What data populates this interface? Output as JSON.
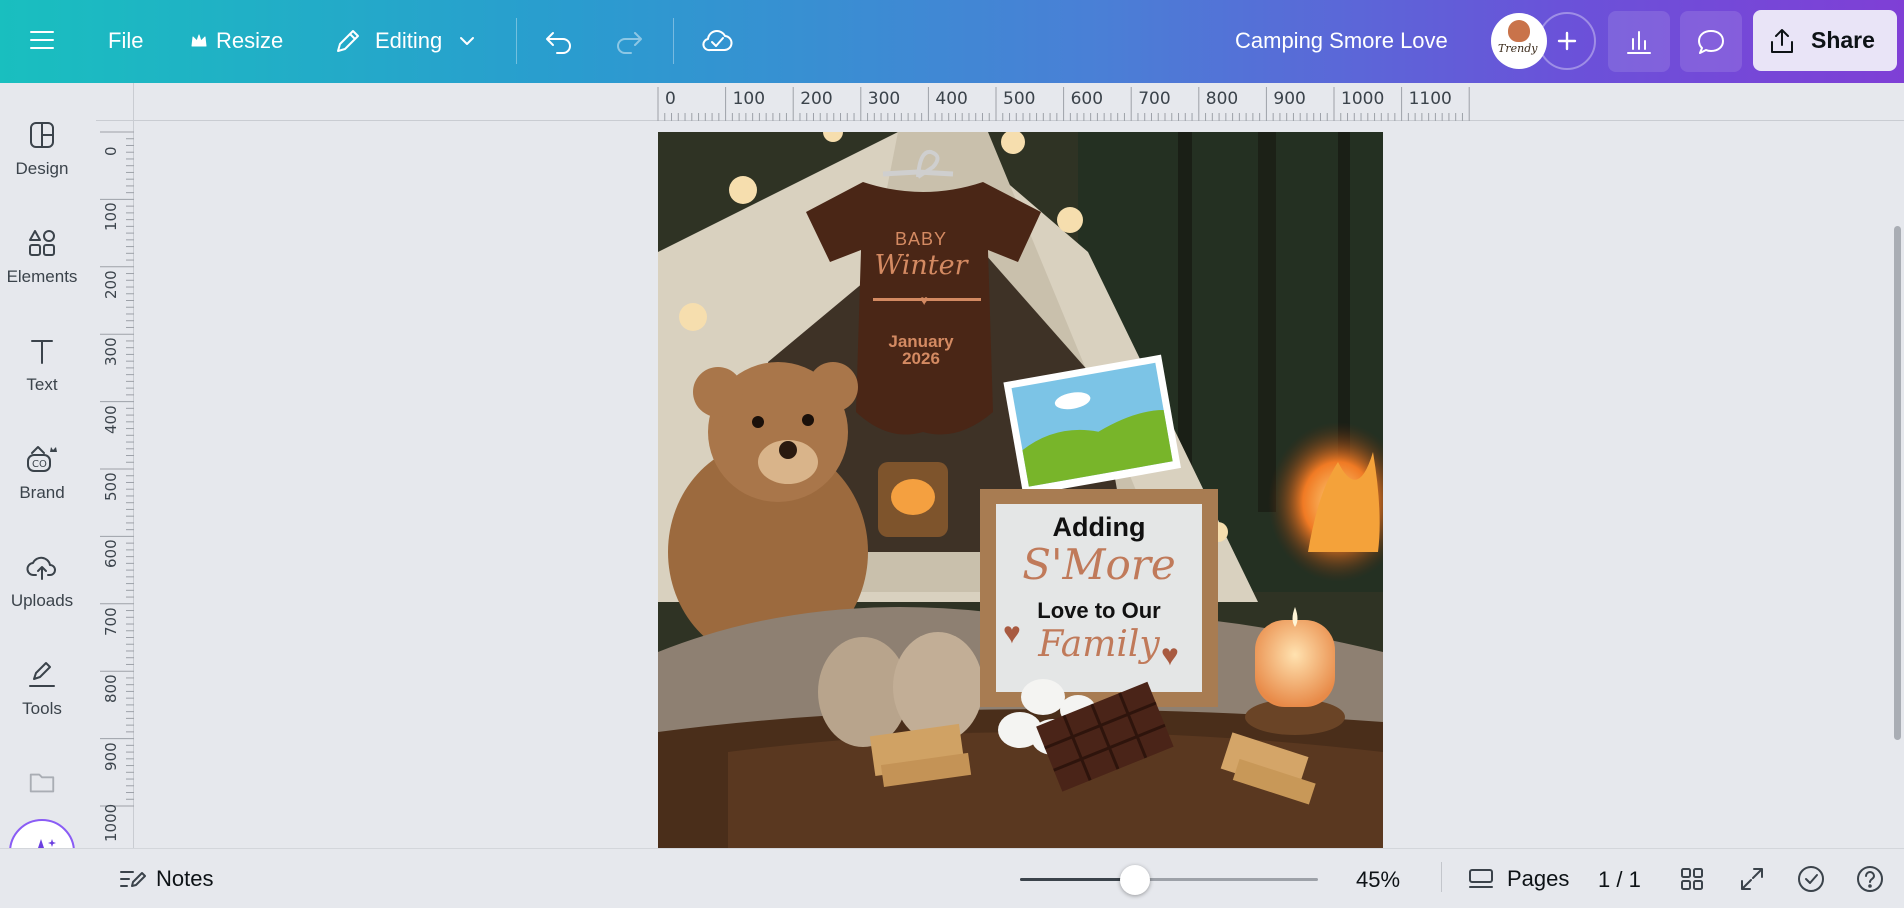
{
  "topbar": {
    "file_label": "File",
    "resize_label": "Resize",
    "editing_label": "Editing",
    "design_title": "Camping Smore Love",
    "share_label": "Share",
    "avatar_text": "Trendy"
  },
  "sidebar": {
    "items": [
      {
        "label": "Design",
        "icon": "design-layout-icon"
      },
      {
        "label": "Elements",
        "icon": "shapes-icon"
      },
      {
        "label": "Text",
        "icon": "text-t-icon"
      },
      {
        "label": "Brand",
        "icon": "brand-kit-icon"
      },
      {
        "label": "Uploads",
        "icon": "cloud-upload-icon"
      },
      {
        "label": "Tools",
        "icon": "pen-tool-icon"
      }
    ]
  },
  "ruler": {
    "top_ticks": [
      "0",
      "100",
      "200",
      "300",
      "400",
      "500",
      "600",
      "700",
      "800",
      "900",
      "1000",
      "1100"
    ],
    "left_ticks": [
      "0",
      "100",
      "200",
      "300",
      "400",
      "500",
      "600",
      "700",
      "800",
      "900",
      "1000"
    ]
  },
  "design": {
    "onesie_line1": "BABY",
    "onesie_line2": "Winter",
    "onesie_line3": "January",
    "onesie_line4": "2026",
    "frame_line1": "Adding",
    "frame_line2": "S'More",
    "frame_line3": "Love to Our",
    "frame_line4": "Family"
  },
  "bottombar": {
    "notes_label": "Notes",
    "zoom_level": "45%",
    "zoom_fraction": 0.45,
    "pages_label": "Pages",
    "page_counter": "1 / 1"
  },
  "colors": {
    "accent_teal": "#19bfbf",
    "accent_purple": "#7f3fd6",
    "share_bg": "#e9e4f7",
    "copper_text": "#c98a6a"
  }
}
